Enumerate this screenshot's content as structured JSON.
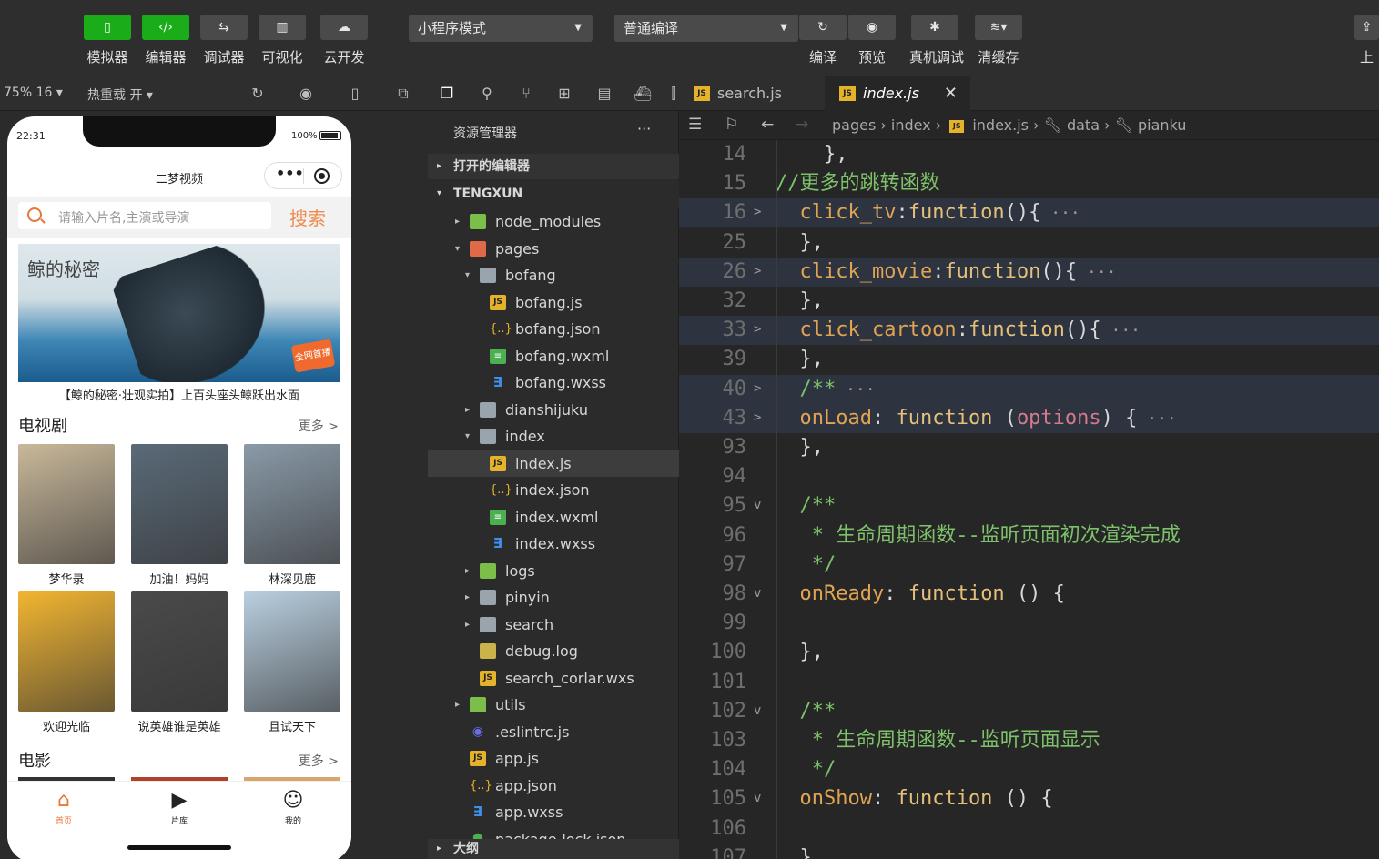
{
  "toolbar": {
    "buttons": [
      {
        "label": "模拟器",
        "icon": "phone-icon"
      },
      {
        "label": "编辑器",
        "icon": "code-icon"
      },
      {
        "label": "调试器",
        "icon": "sliders-icon"
      },
      {
        "label": "可视化",
        "icon": "layout-icon"
      },
      {
        "label": "云开发",
        "icon": "cloud-icon"
      }
    ],
    "mode_select": "小程序模式",
    "compile_select": "普通编译",
    "right_buttons": [
      {
        "label": "编译",
        "icon": "refresh-icon"
      },
      {
        "label": "预览",
        "icon": "eye-icon"
      },
      {
        "label": "真机调试",
        "icon": "bug-icon"
      },
      {
        "label": "清缓存",
        "icon": "layers-icon"
      }
    ],
    "edge_label": "上"
  },
  "simulator": {
    "zoom": "75% 16",
    "hot_reload": "热重载 开",
    "status_time": "22:31",
    "battery": "100%",
    "nav_title": "二梦视频",
    "search_placeholder": "请输入片名,主演或导演",
    "search_button": "搜索",
    "banner_title": "鲸的秘密",
    "banner_badge": "全网首播",
    "banner_caption": "【鲸的秘密·壮观实拍】上百头座头鲸跃出水面",
    "tv_section": "电视剧",
    "more_label": "更多 >",
    "tv_cards": [
      {
        "title": "梦华录",
        "color": "#c9b89a"
      },
      {
        "title": "加油！妈妈",
        "color": "#5a6a78"
      },
      {
        "title": "林深见鹿",
        "color": "#8a9aa8"
      },
      {
        "title": "欢迎光临",
        "color": "#f2b531"
      },
      {
        "title": "说英雄谁是英雄",
        "color": "#4a4a4a"
      },
      {
        "title": "且试天下",
        "color": "#b9cfe0"
      }
    ],
    "movie_section": "电影",
    "tabbar": [
      {
        "label": "首页",
        "icon": "home-icon"
      },
      {
        "label": "片库",
        "icon": "play-icon"
      },
      {
        "label": "我的",
        "icon": "user-icon"
      }
    ]
  },
  "explorer": {
    "title": "资源管理器",
    "more": "···",
    "open_editors": "打开的编辑器",
    "project": "TENGXUN",
    "outline": "大纲",
    "tree": [
      {
        "name": "node_modules",
        "type": "folder-green",
        "depth": 0,
        "arrow": "▸"
      },
      {
        "name": "pages",
        "type": "folder-red",
        "depth": 0,
        "arrow": "▾"
      },
      {
        "name": "bofang",
        "type": "folder",
        "depth": 1,
        "arrow": "▾"
      },
      {
        "name": "bofang.js",
        "type": "js",
        "depth": 2,
        "arrow": ""
      },
      {
        "name": "bofang.json",
        "type": "json",
        "depth": 2,
        "arrow": ""
      },
      {
        "name": "bofang.wxml",
        "type": "wxml",
        "depth": 2,
        "arrow": ""
      },
      {
        "name": "bofang.wxss",
        "type": "wxss",
        "depth": 2,
        "arrow": ""
      },
      {
        "name": "dianshijuku",
        "type": "folder",
        "depth": 1,
        "arrow": "▸"
      },
      {
        "name": "index",
        "type": "folder",
        "depth": 1,
        "arrow": "▾"
      },
      {
        "name": "index.js",
        "type": "js",
        "depth": 2,
        "arrow": "",
        "selected": true
      },
      {
        "name": "index.json",
        "type": "json",
        "depth": 2,
        "arrow": ""
      },
      {
        "name": "index.wxml",
        "type": "wxml",
        "depth": 2,
        "arrow": ""
      },
      {
        "name": "index.wxss",
        "type": "wxss",
        "depth": 2,
        "arrow": ""
      },
      {
        "name": "logs",
        "type": "folder-green",
        "depth": 1,
        "arrow": "▸"
      },
      {
        "name": "pinyin",
        "type": "folder",
        "depth": 1,
        "arrow": "▸"
      },
      {
        "name": "search",
        "type": "folder",
        "depth": 1,
        "arrow": "▸"
      },
      {
        "name": "debug.log",
        "type": "log",
        "depth": 1,
        "arrow": ""
      },
      {
        "name": "search_corlar.wxs",
        "type": "js",
        "depth": 1,
        "arrow": ""
      },
      {
        "name": "utils",
        "type": "folder-green",
        "depth": 0,
        "arrow": "▸"
      },
      {
        "name": ".eslintrc.js",
        "type": "eslint",
        "depth": 0,
        "arrow": ""
      },
      {
        "name": "app.js",
        "type": "js",
        "depth": 0,
        "arrow": ""
      },
      {
        "name": "app.json",
        "type": "json",
        "depth": 0,
        "arrow": ""
      },
      {
        "name": "app.wxss",
        "type": "wxss",
        "depth": 0,
        "arrow": ""
      },
      {
        "name": "package-lock.json",
        "type": "pkg",
        "depth": 0,
        "arrow": ""
      }
    ]
  },
  "editor": {
    "tabs": [
      {
        "label": "search.js",
        "active": false
      },
      {
        "label": "index.js",
        "active": true
      }
    ],
    "close": "✕",
    "breadcrumb": [
      "pages",
      "index",
      "index.js",
      "data",
      "pianku"
    ],
    "lines": [
      {
        "num": "14",
        "fold": "",
        "hl": false,
        "parts": [
          [
            "p",
            "    },"
          ]
        ]
      },
      {
        "num": "15",
        "fold": "",
        "hl": false,
        "parts": [
          [
            "cm",
            "//更多的跳转函数"
          ]
        ]
      },
      {
        "num": "16",
        "fold": ">",
        "hl": true,
        "parts": [
          [
            "prop",
            "  click_tv"
          ],
          [
            "p",
            ":"
          ],
          [
            "kw",
            "function"
          ],
          [
            "p",
            "(){"
          ],
          [
            "fd",
            " ···"
          ]
        ]
      },
      {
        "num": "25",
        "fold": "",
        "hl": false,
        "parts": [
          [
            "p",
            "  },"
          ]
        ]
      },
      {
        "num": "26",
        "fold": ">",
        "hl": true,
        "parts": [
          [
            "prop",
            "  click_movie"
          ],
          [
            "p",
            ":"
          ],
          [
            "kw",
            "function"
          ],
          [
            "p",
            "(){"
          ],
          [
            "fd",
            " ···"
          ]
        ]
      },
      {
        "num": "32",
        "fold": "",
        "hl": false,
        "parts": [
          [
            "p",
            "  },"
          ]
        ]
      },
      {
        "num": "33",
        "fold": ">",
        "hl": true,
        "parts": [
          [
            "prop",
            "  click_cartoon"
          ],
          [
            "p",
            ":"
          ],
          [
            "kw",
            "function"
          ],
          [
            "p",
            "(){"
          ],
          [
            "fd",
            " ···"
          ]
        ]
      },
      {
        "num": "39",
        "fold": "",
        "hl": false,
        "parts": [
          [
            "p",
            "  },"
          ]
        ]
      },
      {
        "num": "40",
        "fold": ">",
        "hl": true,
        "parts": [
          [
            "cm",
            "  /**"
          ],
          [
            "fd",
            " ···"
          ]
        ]
      },
      {
        "num": "43",
        "fold": ">",
        "hl": true,
        "parts": [
          [
            "prop",
            "  onLoad"
          ],
          [
            "p",
            ": "
          ],
          [
            "kw",
            "function"
          ],
          [
            "p",
            " ("
          ],
          [
            "arg",
            "options"
          ],
          [
            "p",
            ") {"
          ],
          [
            "fd",
            " ···"
          ]
        ]
      },
      {
        "num": "93",
        "fold": "",
        "hl": false,
        "parts": [
          [
            "p",
            "  },"
          ]
        ]
      },
      {
        "num": "94",
        "fold": "",
        "hl": false,
        "parts": [
          [
            "p",
            ""
          ]
        ]
      },
      {
        "num": "95",
        "fold": "v",
        "hl": false,
        "parts": [
          [
            "cm",
            "  /**"
          ]
        ]
      },
      {
        "num": "96",
        "fold": "",
        "hl": false,
        "parts": [
          [
            "cm",
            "   * 生命周期函数--监听页面初次渲染完成"
          ]
        ]
      },
      {
        "num": "97",
        "fold": "",
        "hl": false,
        "parts": [
          [
            "cm",
            "   */"
          ]
        ]
      },
      {
        "num": "98",
        "fold": "v",
        "hl": false,
        "parts": [
          [
            "prop",
            "  onReady"
          ],
          [
            "p",
            ": "
          ],
          [
            "kw",
            "function"
          ],
          [
            "p",
            " () {"
          ]
        ]
      },
      {
        "num": "99",
        "fold": "",
        "hl": false,
        "parts": [
          [
            "p",
            ""
          ]
        ]
      },
      {
        "num": "100",
        "fold": "",
        "hl": false,
        "parts": [
          [
            "p",
            "  },"
          ]
        ]
      },
      {
        "num": "101",
        "fold": "",
        "hl": false,
        "parts": [
          [
            "p",
            ""
          ]
        ]
      },
      {
        "num": "102",
        "fold": "v",
        "hl": false,
        "parts": [
          [
            "cm",
            "  /**"
          ]
        ]
      },
      {
        "num": "103",
        "fold": "",
        "hl": false,
        "parts": [
          [
            "cm",
            "   * 生命周期函数--监听页面显示"
          ]
        ]
      },
      {
        "num": "104",
        "fold": "",
        "hl": false,
        "parts": [
          [
            "cm",
            "   */"
          ]
        ]
      },
      {
        "num": "105",
        "fold": "v",
        "hl": false,
        "parts": [
          [
            "prop",
            "  onShow"
          ],
          [
            "p",
            ": "
          ],
          [
            "kw",
            "function"
          ],
          [
            "p",
            " () {"
          ]
        ]
      },
      {
        "num": "106",
        "fold": "",
        "hl": false,
        "parts": [
          [
            "p",
            ""
          ]
        ]
      },
      {
        "num": "107",
        "fold": "",
        "hl": false,
        "parts": [
          [
            "p",
            "  },"
          ]
        ]
      }
    ]
  }
}
